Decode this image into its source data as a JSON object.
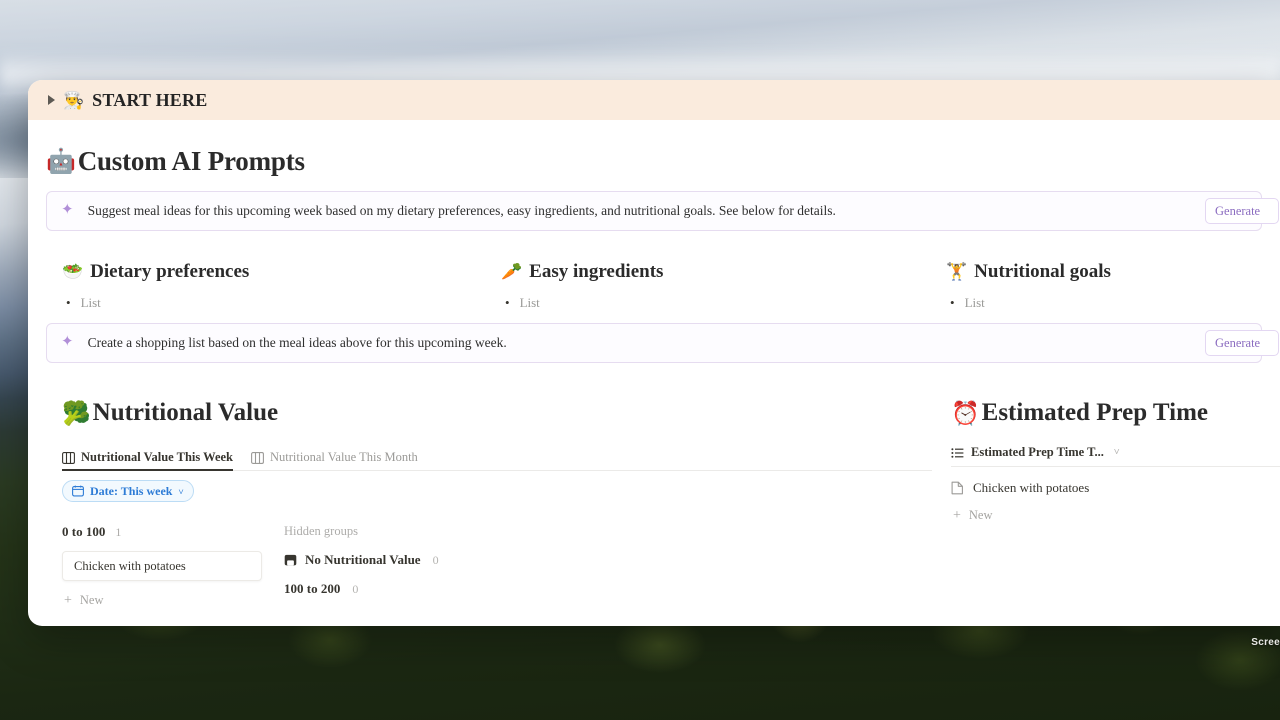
{
  "background": {
    "description": "aerial landscape photo: cloudy sky over distant blue mountains with dark green forest below",
    "sky_color": "#cfd7e0",
    "mountain_color": "#4a5e74",
    "forest_color": "#1f2c14"
  },
  "callout": {
    "emoji": "👨‍🍳",
    "label": "START HERE",
    "background": "#faebdd",
    "toggle": "collapsed"
  },
  "prompts_section": {
    "emoji": "🤖",
    "title": "Custom AI Prompts",
    "rows": [
      {
        "icon": "sparkle-icon",
        "text": "Suggest meal ideas for this upcoming week based on my dietary preferences, easy ingredients, and nutritional goals. See below for details.",
        "button_label": "Generate",
        "accent": "#8b6cc0"
      },
      {
        "icon": "sparkle-icon",
        "text": "Create a shopping list based on the meal ideas above for this upcoming week.",
        "button_label": "Generate",
        "accent": "#8b6cc0"
      }
    ]
  },
  "columns": [
    {
      "emoji": "🥗",
      "title": "Dietary preferences",
      "items": [
        "List"
      ]
    },
    {
      "emoji": "🥕",
      "title": "Easy ingredients",
      "items": [
        "List"
      ]
    },
    {
      "emoji": "🏋️",
      "title": "Nutritional goals",
      "items": [
        "List"
      ]
    }
  ],
  "nutritional_value_db": {
    "emoji": "🥦",
    "title": "Nutritional Value",
    "tabs": [
      {
        "icon": "board-view-icon",
        "label": "Nutritional Value This Week",
        "active": true
      },
      {
        "icon": "board-view-icon",
        "label": "Nutritional Value This Month",
        "active": false
      }
    ],
    "filter_chip": {
      "icon": "calendar-icon",
      "label": "Date: This week",
      "chevron": "˅",
      "color": "#2e7cd6"
    },
    "groups": [
      {
        "name": "0 to 100",
        "count": "1",
        "cards": [
          "Chicken with potatoes"
        ],
        "new_label": "New"
      }
    ],
    "hidden_groups_label": "Hidden groups",
    "hidden_groups": [
      {
        "icon": "inbox-icon",
        "name": "No Nutritional Value",
        "count": "0"
      },
      {
        "icon": "",
        "name": "100 to 200",
        "count": "0"
      }
    ]
  },
  "prep_time_db": {
    "emoji": "⏰",
    "title": "Estimated Prep Time",
    "view": {
      "icon": "list-view-icon",
      "label": "Estimated Prep Time T...",
      "chevron": "˅"
    },
    "rows": [
      {
        "icon": "page-icon",
        "label": "Chicken with potatoes"
      }
    ],
    "new_label": "New"
  },
  "watermark": {
    "text": "Scree"
  }
}
